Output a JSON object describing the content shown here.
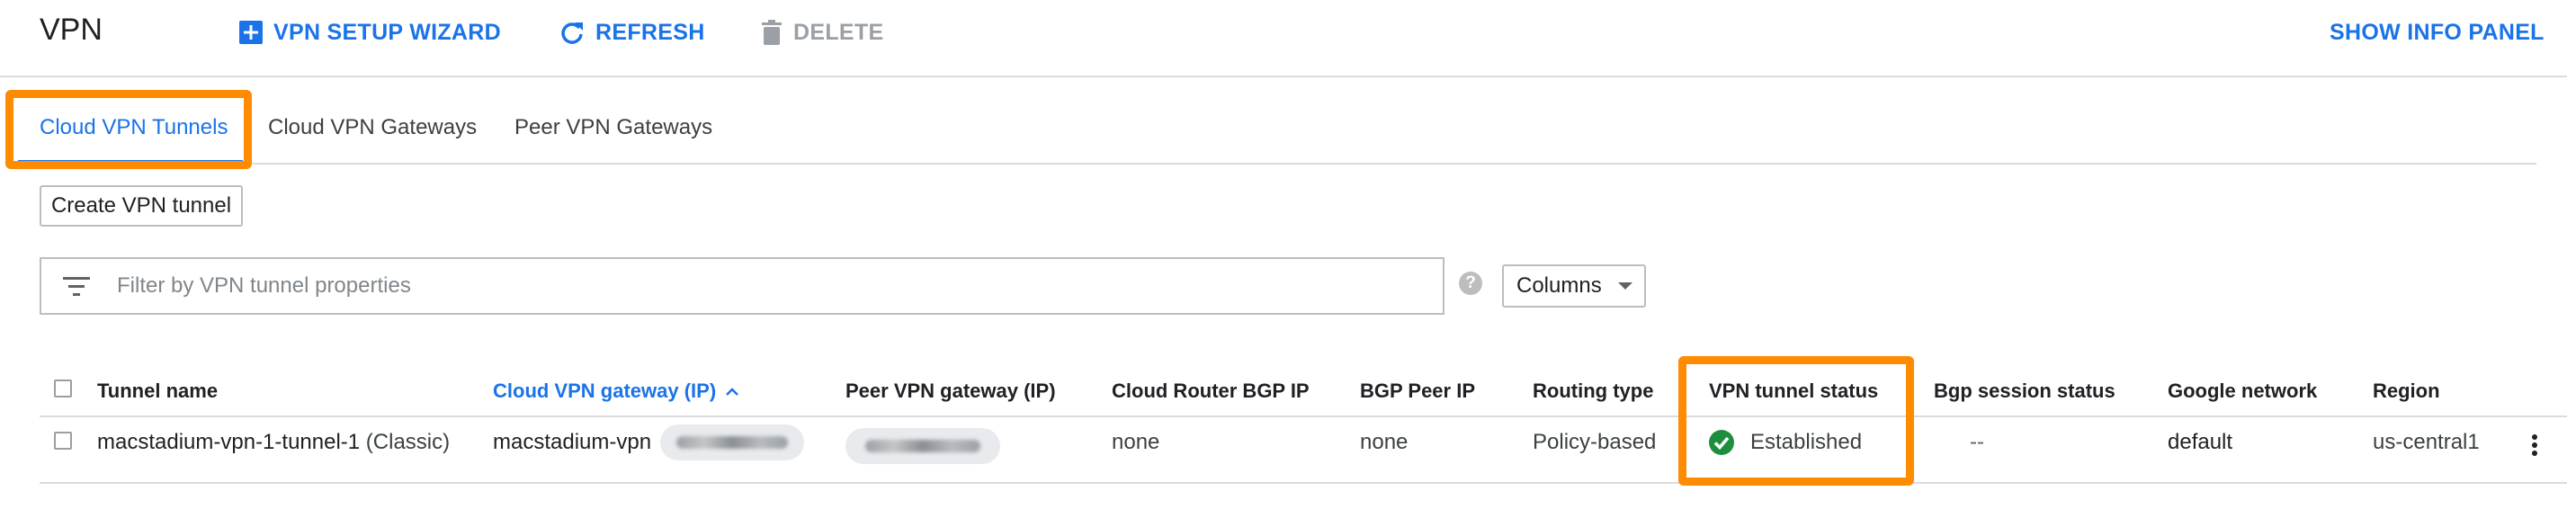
{
  "header": {
    "title": "VPN",
    "setup_wizard": "VPN SETUP WIZARD",
    "refresh": "REFRESH",
    "delete": "DELETE",
    "show_info_panel": "SHOW INFO PANEL"
  },
  "tabs": [
    {
      "label": "Cloud VPN Tunnels",
      "active": true
    },
    {
      "label": "Cloud VPN Gateways",
      "active": false
    },
    {
      "label": "Peer VPN Gateways",
      "active": false
    }
  ],
  "actions": {
    "create_label": "Create VPN tunnel"
  },
  "filter": {
    "placeholder": "Filter by VPN tunnel properties",
    "help": "?"
  },
  "columns_button": {
    "label": "Columns"
  },
  "table": {
    "headers": {
      "tunnel_name": "Tunnel name",
      "cloud_gateway": "Cloud VPN gateway (IP)",
      "peer_gateway": "Peer VPN gateway (IP)",
      "router_bgp_ip": "Cloud Router BGP IP",
      "bgp_peer_ip": "BGP Peer IP",
      "routing_type": "Routing type",
      "tunnel_status": "VPN tunnel status",
      "bgp_status": "Bgp session status",
      "network": "Google network",
      "region": "Region"
    },
    "rows": [
      {
        "tunnel_name": "macstadium-vpn-1-tunnel-1",
        "tunnel_type": "(Classic)",
        "cloud_gateway": "macstadium-vpn",
        "router_bgp_ip": "none",
        "bgp_peer_ip": "none",
        "routing_type": "Policy-based",
        "tunnel_status": "Established",
        "bgp_status": "--",
        "network": "default",
        "region": "us-central1"
      }
    ]
  },
  "colors": {
    "accent": "#1a73e8",
    "highlight": "#ff8c00",
    "success": "#1e8e3e"
  }
}
